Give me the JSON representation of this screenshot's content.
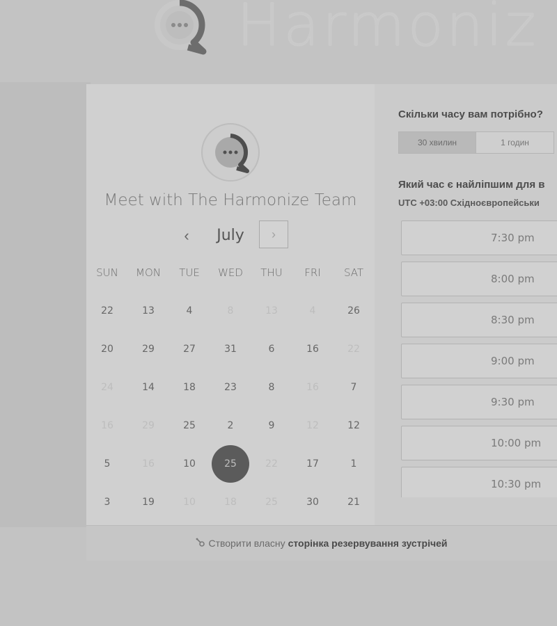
{
  "brand": {
    "wordmark": "Harmoniz",
    "logo": "chat-bubble-logo"
  },
  "calendar": {
    "title": "Meet with The Harmonize Team",
    "month": "July",
    "prev_icon": "‹",
    "next_icon": "›",
    "weekdays": [
      "SUN",
      "MON",
      "TUE",
      "WED",
      "THU",
      "FRI",
      "SAT"
    ],
    "weeks": [
      [
        {
          "d": "22"
        },
        {
          "d": "13"
        },
        {
          "d": "4"
        },
        {
          "d": "8",
          "muted": true
        },
        {
          "d": "13",
          "muted": true
        },
        {
          "d": "4",
          "muted": true
        },
        {
          "d": "26"
        }
      ],
      [
        {
          "d": "20"
        },
        {
          "d": "29"
        },
        {
          "d": "27"
        },
        {
          "d": "31"
        },
        {
          "d": "6"
        },
        {
          "d": "16"
        },
        {
          "d": "22",
          "muted": true
        }
      ],
      [
        {
          "d": "24",
          "muted": true
        },
        {
          "d": "14"
        },
        {
          "d": "18"
        },
        {
          "d": "23"
        },
        {
          "d": "8"
        },
        {
          "d": "16",
          "muted": true
        },
        {
          "d": "7"
        }
      ],
      [
        {
          "d": "16",
          "muted": true
        },
        {
          "d": "29",
          "muted": true
        },
        {
          "d": "25"
        },
        {
          "d": "2"
        },
        {
          "d": "9"
        },
        {
          "d": "12",
          "muted": true
        },
        {
          "d": "12"
        }
      ],
      [
        {
          "d": "5"
        },
        {
          "d": "16",
          "muted": true
        },
        {
          "d": "10"
        },
        {
          "d": "25",
          "selected": true
        },
        {
          "d": "22",
          "muted": true
        },
        {
          "d": "17"
        },
        {
          "d": "1"
        }
      ],
      [
        {
          "d": "3"
        },
        {
          "d": "19"
        },
        {
          "d": "10",
          "muted": true
        },
        {
          "d": "18",
          "muted": true
        },
        {
          "d": "25",
          "muted": true
        },
        {
          "d": "30"
        },
        {
          "d": "21"
        }
      ]
    ]
  },
  "booking": {
    "duration_question": "Скільки часу вам потрібно?",
    "durations": [
      {
        "label": "30 хвилин",
        "active": true
      },
      {
        "label": "1 годин",
        "active": false
      }
    ],
    "time_question": "Який час є найліпшим для в",
    "timezone": "UTC +03:00 Східноєвропейськи",
    "slots": [
      "7:30 pm",
      "8:00 pm",
      "8:30 pm",
      "9:00 pm",
      "9:30 pm",
      "10:00 pm",
      "10:30 pm"
    ]
  },
  "footer": {
    "icon": "sprocket-icon",
    "prefix": "Створити власну",
    "link": "сторінка резервування зустрічей"
  }
}
